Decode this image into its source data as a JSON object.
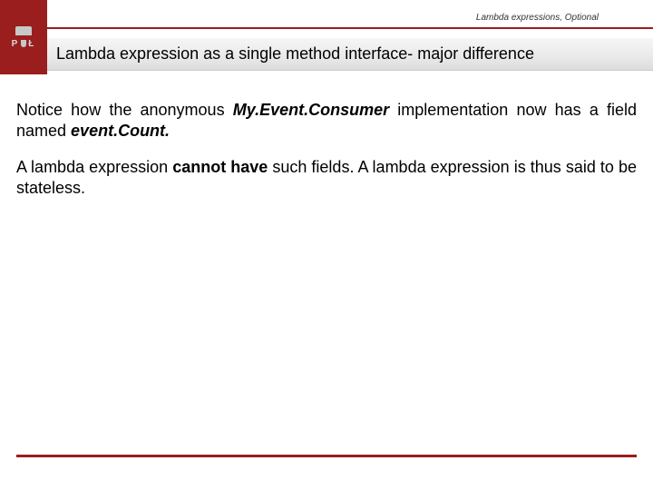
{
  "header": {
    "breadcrumb": "Lambda expressions, Optional",
    "title": "Lambda expression as a single method interface- major difference",
    "logo_left": "P",
    "logo_right": "Ł"
  },
  "body": {
    "p1_a": "Notice how the anonymous ",
    "p1_b": "My.Event.Consumer",
    "p1_c": " implementation now has a field named ",
    "p1_d": "event.Count.",
    "p2_a": "A lambda expression ",
    "p2_b": "cannot have",
    "p2_c": " such fields. A lambda expression is thus said to be stateless."
  }
}
